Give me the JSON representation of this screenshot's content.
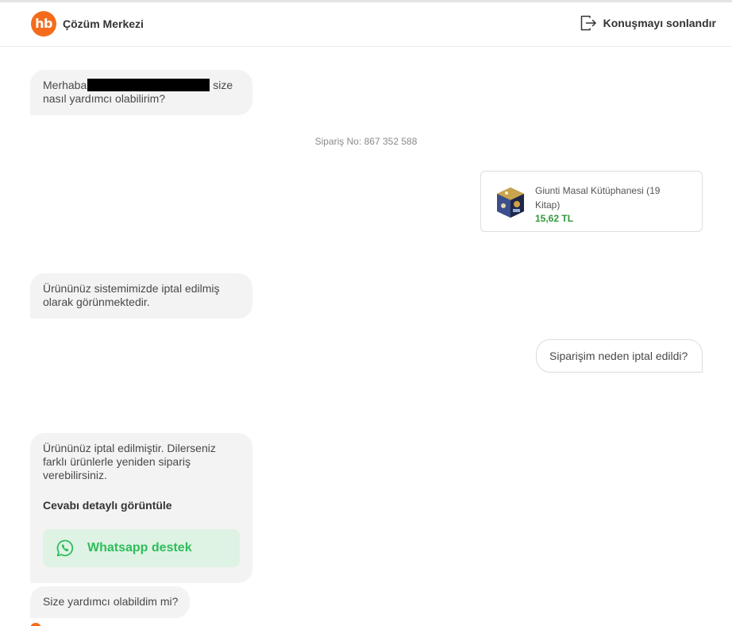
{
  "header": {
    "logo_text": "hb",
    "title": "Çözüm Merkezi",
    "end_chat_label": "Konuşmayı sonlandır",
    "end_chat_icon": "logout-icon"
  },
  "messages": {
    "greeting_prefix": "Merhaba",
    "greeting_suffix": "size",
    "greeting_line2": "nasıl yardımcı olabilirim?",
    "order_number": "Sipariş No: 867 352 588",
    "product": {
      "name": "Giunti Masal Kütüphanesi (19 Kitap)",
      "price": "15,62 TL",
      "price_color": "#2f9a3c"
    },
    "cancel_status": "Ürününüz sistemimizde iptal edilmiş olarak görünmektedir.",
    "user_question": "Siparişim neden iptal edildi?",
    "cancel_answer": "Ürününüz iptal edilmiştir. Dilerseniz farklı ürünlerle yeniden sipariş verebilirsiniz.",
    "detail_link": "Cevabı detaylı görüntüle",
    "whatsapp_button": "Whatsapp destek",
    "whatsapp_icon": "whatsapp-icon",
    "followup": "Size yardımcı olabildim mi?"
  },
  "colors": {
    "brand": "#f46c1b",
    "whatsapp_green": "#2ebd59",
    "whatsapp_bg": "#dff3e5"
  }
}
